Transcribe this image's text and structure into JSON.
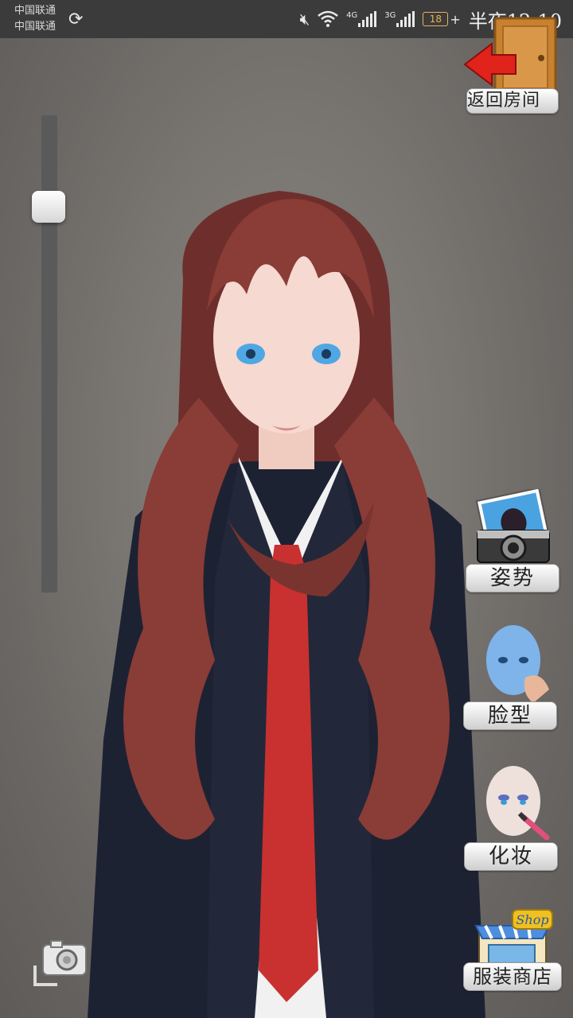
{
  "status_bar": {
    "carrier_1": "中国联通",
    "carrier_2": "中国联通",
    "network_1": "4G",
    "network_2": "3G",
    "battery": "18",
    "time": "半夜12:10"
  },
  "top": {
    "back_label": "返回房间"
  },
  "side_menu": {
    "pose_label": "姿势",
    "face_label": "脸型",
    "makeup_label": "化妆",
    "shop_label": "服装商店",
    "shop_sign": "Shop"
  },
  "slider": {
    "level": 0.17
  },
  "colors": {
    "background": "#7a7672",
    "status_bar": "#3b3b3b",
    "hair": "#8a3c36",
    "blazer": "#1d2233",
    "tie": "#c8312f",
    "back_arrow": "#e0231b",
    "door": "#c8822f"
  }
}
